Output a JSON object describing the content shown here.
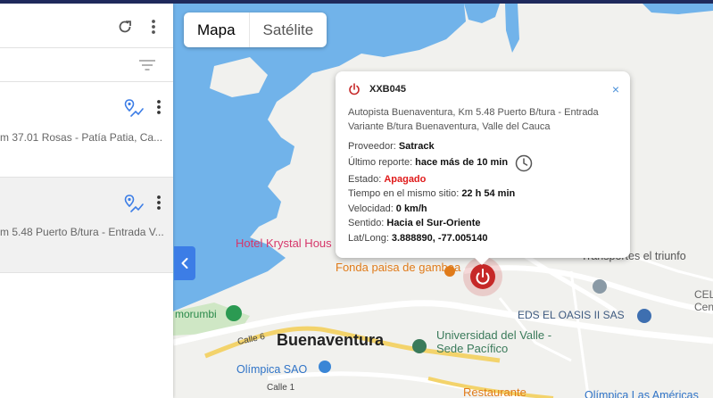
{
  "panel": {
    "refresh_icon": "refresh-icon",
    "menu_icon": "more-vert-icon",
    "filter_icon": "filter-list-icon",
    "items": [
      {
        "address": "m 37.01 Rosas - Patía Patia, Ca...",
        "route_icon": "route-icon",
        "menu_icon": "more-vert-icon"
      },
      {
        "address": "m 5.48 Puerto B/tura - Entrada V...",
        "route_icon": "route-icon",
        "menu_icon": "more-vert-icon"
      }
    ],
    "collapse_icon": "chevron-left-icon"
  },
  "map_type": {
    "map_label": "Mapa",
    "satellite_label": "Satélite"
  },
  "info_window": {
    "plate": "XXB045",
    "close_label": "×",
    "address": "Autopista Buenaventura, Km 5.48 Puerto B/tura - Entrada Variante B/tura Buenaventura, Valle del Cauca",
    "rows": [
      {
        "label": "Proveedor:",
        "value": "Satrack"
      },
      {
        "label": "Último reporte:",
        "value": "hace más de 10 min"
      },
      {
        "label": "Estado:",
        "value": "Apagado"
      },
      {
        "label": "Tiempo en el mismo sitio:",
        "value": "22 h 54 min"
      },
      {
        "label": "Velocidad:",
        "value": "0 km/h"
      },
      {
        "label": "Sentido:",
        "value": "Hacia el Sur-Oriente"
      },
      {
        "label": "Lat/Long:",
        "value": "3.888890, -77.005140"
      }
    ],
    "status_color": "#e01b1b"
  },
  "map_labels": {
    "hotel": "Hotel Krystal Hous",
    "fonda": "Fonda paisa de gamboa",
    "transportes": "Transportes el triunfo",
    "city": "Buenaventura",
    "university_1": "Universidad del Valle -",
    "university_2": "Sede Pacífico",
    "eds": "EDS EL OASIS II SAS",
    "morumbi": "morumbi",
    "olimpica": "Olímpica SAO",
    "olimpica2": "Olímpica Las Américas",
    "restaurante": "Restaurante",
    "calle6": "Calle 6",
    "calle1": "Calle 1",
    "cel": "CEL",
    "cel2": "Centr"
  },
  "colors": {
    "water": "#6fb0e8",
    "accent": "#3c7de6",
    "marker": "#c62828",
    "topbar": "#1f2a5c"
  }
}
